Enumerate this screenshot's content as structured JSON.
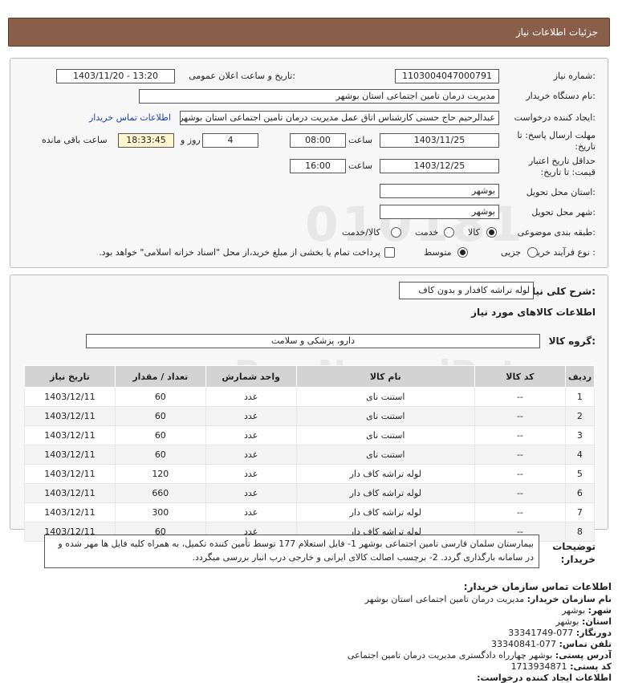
{
  "header": {
    "title": "جزئیات اطلاعات نیاز"
  },
  "form": {
    "need_number_label": "شماره نیاز:",
    "need_number": "1103004047000791",
    "announce_label": "تاریخ و ساعت اعلان عمومی:",
    "announce_value": "1403/11/20 - 13:20",
    "buyer_org_label": "نام دستگاه خریدار:",
    "buyer_org": "مدیریت درمان تامین اجتماعی استان بوشهر",
    "requester_label": "ایجاد کننده درخواست:",
    "requester": "عبدالرحیم حاج حسنی کارشناس اتاق عمل مدیریت درمان تامین اجتماعی استان بوشهر",
    "contact_link": "اطلاعات تماس خریدار",
    "deadline_label": "مهلت ارسال پاسخ: تا تاریخ:",
    "deadline_date": "1403/11/25",
    "time_label": "ساعت",
    "deadline_time": "08:00",
    "days_value": "4",
    "days_label": "روز و",
    "remaining_time": "18:33:45",
    "remaining_label": "ساعت باقی مانده",
    "validity_label": "حداقل تاریخ اعتبار قیمت: تا تاریخ:",
    "validity_date": "1403/12/25",
    "validity_time": "16:00",
    "province_label": "استان محل تحویل:",
    "province": "بوشهر",
    "city_label": "شهر محل تحویل:",
    "city": "بوشهر",
    "category_label": "طبقه بندی موضوعی:",
    "category_options": [
      "کالا",
      "خدمت",
      "کالا/خدمت"
    ],
    "purchase_type_label": "نوع فرآیند خرید :",
    "purchase_options": [
      "جزیی",
      "متوسط"
    ],
    "payment_note": "پرداخت تمام یا بخشی از مبلغ خرید،از محل \"اسناد خزانه اسلامی\" خواهد بود."
  },
  "description": {
    "label": "شرح کلی نیاز:",
    "value": "لوله تراشه کافدار و بدون کاف",
    "goods_info_title": "اطلاعات کالاهای مورد نیاز",
    "group_label": "گروه کالا:",
    "group_value": "دارو، پزشکی و سلامت"
  },
  "table": {
    "headers": [
      "ردیف",
      "کد کالا",
      "نام کالا",
      "واحد شمارش",
      "تعداد / مقدار",
      "تاریخ نیاز"
    ],
    "rows": [
      [
        "1",
        "--",
        "استنت نای",
        "عدد",
        "60",
        "1403/12/11"
      ],
      [
        "2",
        "--",
        "استنت نای",
        "عدد",
        "60",
        "1403/12/11"
      ],
      [
        "3",
        "--",
        "استنت نای",
        "عدد",
        "60",
        "1403/12/11"
      ],
      [
        "4",
        "--",
        "استنت نای",
        "عدد",
        "60",
        "1403/12/11"
      ],
      [
        "5",
        "--",
        "لوله تراشه کاف دار",
        "عدد",
        "120",
        "1403/12/11"
      ],
      [
        "6",
        "--",
        "لوله تراشه کاف دار",
        "عدد",
        "660",
        "1403/12/11"
      ],
      [
        "7",
        "--",
        "لوله تراشه کاف دار",
        "عدد",
        "300",
        "1403/12/11"
      ],
      [
        "8",
        "--",
        "لوله تراشه کاف دار",
        "عدد",
        "60",
        "1403/12/11"
      ]
    ]
  },
  "notes": {
    "label": "توضیحات خریدار:",
    "text": "بیمارستان سلمان فارسی تامین اجتماعی بوشهر 1- فایل استعلام 177 توسط تأمین کننده تکمیل، به همراه کلیه فایل ها مهر شده و در سامانه بارگذاری گردد. 2- برچسب اصالت کالای ایرانی و خارجی درب انبار بررسی میگردد."
  },
  "contact": {
    "title": "اطلاعات تماس سازمان خریدار:",
    "org_label": "نام سازمان خریدار:",
    "org_value": "مدیریت درمان تامین اجتماعی استان بوشهر",
    "city_label": "شهر:",
    "city_value": "بوشهر",
    "province_label": "استان:",
    "province_value": "بوشهر",
    "fax_label": "دورنگار:",
    "fax_value": "077-33341749",
    "phone_label": "تلفن تماس:",
    "phone_value": "077-33340841",
    "address_label": "آدرس پستی:",
    "address_value": "بوشهر چهارراه دادگستری مدیریت درمان تامین اجتماعی",
    "postal_label": "کد پستی:",
    "postal_value": "1713934871",
    "creator_label": "اطلاعات ایجاد کننده درخواست:"
  },
  "watermark": {
    "logo_text": "ParsNamadData",
    "line1": "مرکز فرآوری اطلاعات پارس نماد داده ها",
    "line2": "پایگاه اطلاع رسانی مناقصه و مزایده",
    "phone": "۰۲۱-۸۸۳۴۹۶۷۰"
  }
}
